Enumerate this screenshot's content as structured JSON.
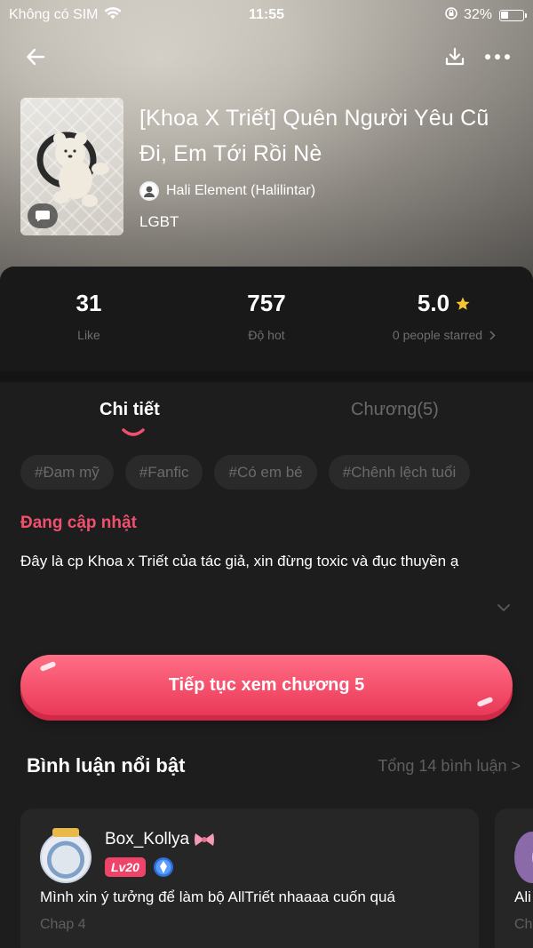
{
  "status_bar": {
    "carrier": "Không có SIM",
    "time": "11:55",
    "battery": "32%"
  },
  "book": {
    "title": "[Khoa X Triết] Quên Người Yêu Cũ Đi, Em Tới Rồi Nè",
    "author": "Hali Element (Halilintar)",
    "category": "LGBT"
  },
  "stats": {
    "likes": "31",
    "likes_label": "Like",
    "hot": "757",
    "hot_label": "Độ hot",
    "rating": "5.0",
    "rating_label": "0 people starred"
  },
  "tabs": {
    "detail": "Chi tiết",
    "chapters": "Chương(5)"
  },
  "tags": [
    "#Đam mỹ",
    "#Fanfic",
    "#Có em bé",
    "#Chênh lệch tuổi"
  ],
  "status_text": "Đang cập nhật",
  "description": "Đây là cp Khoa x Triết của tác giả, xin đừng toxic và đục thuyền ạ",
  "cta_label": "Tiếp tục xem chương 5",
  "comments": {
    "title": "Bình luận nổi bật",
    "total": "Tổng 14 bình luận >",
    "items": [
      {
        "username": "Box_Kollya",
        "level": "Lv20",
        "text": "Mình xin ý tưởng để làm bộ AllTriết nhaaaa cuốn quá",
        "chapter": "Chap 4"
      },
      {
        "text": "Ali",
        "chapter": "Ch"
      }
    ]
  },
  "colors": {
    "accent": "#f0506e",
    "panel": "#1d1d1e",
    "muted": "#6a6a6a"
  }
}
